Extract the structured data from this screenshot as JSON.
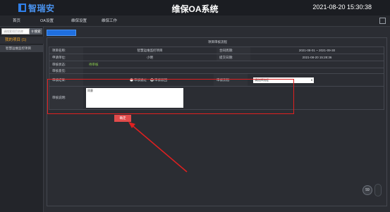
{
  "header": {
    "logo_text": "智瑞安",
    "system_title": "维保OA系统",
    "datetime": "2021-08-20 15:30:38"
  },
  "nav": {
    "items": [
      "首页",
      "OA设置",
      "维保设置",
      "维保工作"
    ]
  },
  "sidebar": {
    "search_placeholder": "请搜索项目名称",
    "search_label": "搜索",
    "my_projects": "我的项目 (1)",
    "project_item": "智慧运维监控项目"
  },
  "main": {
    "tab_label": "",
    "form_title": "项目审核流程",
    "rows": {
      "project_name_label": "项目名称:",
      "project_name_value": "智慧运维监控项目",
      "contract_period_label": "合同周期:",
      "contract_period_value": "2021-08-01 ~ 2021-09-30",
      "applicant_label": "申请单位:",
      "applicant_value": "小明",
      "submit_time_label": "提交日期:",
      "submit_time_value": "2021-08-20 15:28:36",
      "status_label": "审核状态:",
      "status_value": "待审核",
      "opinion_label": "审核意见:"
    },
    "audit": {
      "result_label": "审核结果:",
      "option_pass": "审核通过",
      "option_reject": "审核驳回",
      "flow_label": "审核流程:",
      "flow_select_value": "请选择流程",
      "remark_label": "审核说明:",
      "remark_value": "同意"
    },
    "confirm_label": "确定"
  },
  "widget": {
    "value": "59"
  },
  "colors": {
    "accent": "#1f6fe0",
    "highlight": "#e02020",
    "warning": "#f5a623",
    "status_green": "#8fd14f"
  }
}
